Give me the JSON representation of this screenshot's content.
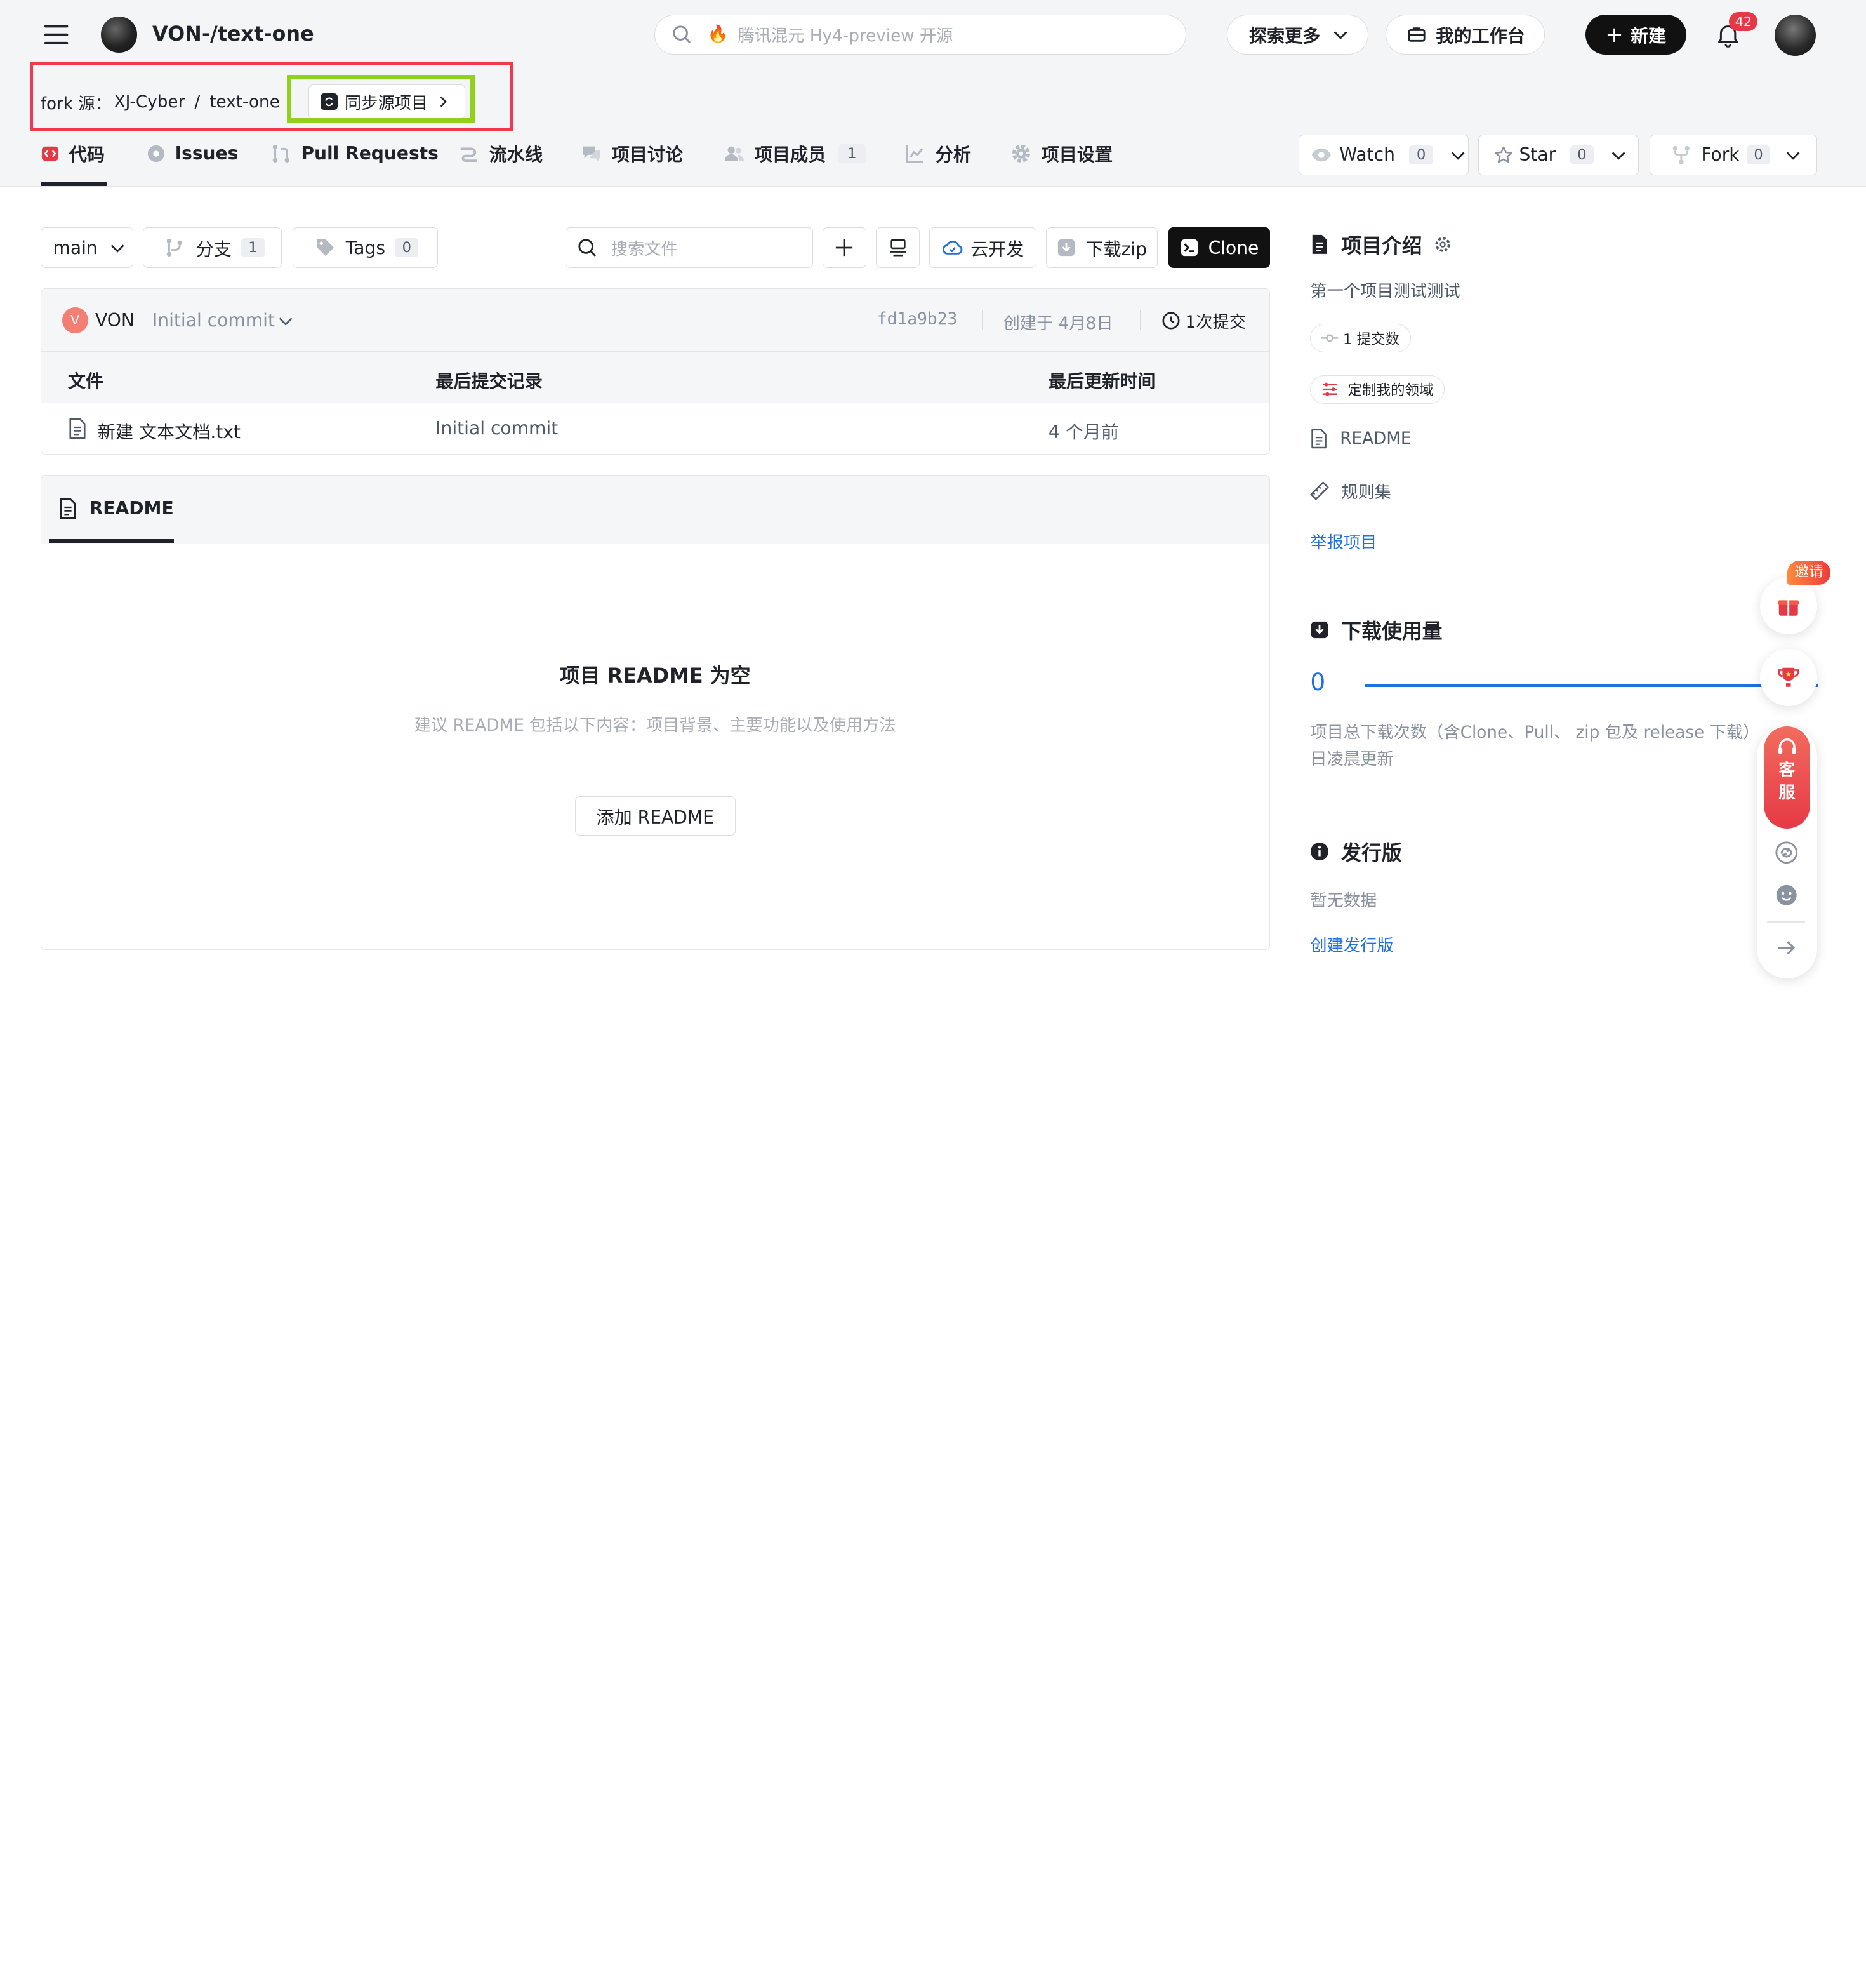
{
  "header": {
    "repo_title": "VON-/text-one",
    "search_placeholder": "腾讯混元 Hy4-preview 开源",
    "explore_label": "探索更多",
    "workbench_label": "我的工作台",
    "new_label": "新建",
    "notif_count": "42"
  },
  "fork": {
    "prefix": "fork 源：",
    "owner": "XJ-Cyber",
    "sep": "/",
    "repo": "text-one",
    "sync_label": "同步源项目"
  },
  "tabs": [
    {
      "label": "代码",
      "count": ""
    },
    {
      "label": "Issues",
      "count": ""
    },
    {
      "label": "Pull Requests",
      "count": ""
    },
    {
      "label": "流水线",
      "count": ""
    },
    {
      "label": "项目讨论",
      "count": ""
    },
    {
      "label": "项目成员",
      "count": "1"
    },
    {
      "label": "分析",
      "count": ""
    },
    {
      "label": "项目设置",
      "count": ""
    }
  ],
  "social": {
    "watch_label": "Watch",
    "watch_count": "0",
    "star_label": "Star",
    "star_count": "0",
    "fork_label": "Fork",
    "fork_count": "0"
  },
  "toolbar": {
    "branch": "main",
    "branches_label": "分支",
    "branches_count": "1",
    "tags_label": "Tags",
    "tags_count": "0",
    "search_placeholder": "搜索文件",
    "cloud_dev_label": "云开发",
    "download_zip_label": "下载zip",
    "clone_label": "Clone"
  },
  "commit": {
    "avatar_letter": "V",
    "author": "VON",
    "message": "Initial commit",
    "hash": "fd1a9b23",
    "created": "创建于 4月8日",
    "commits_label": "1次提交"
  },
  "files": {
    "col_file": "文件",
    "col_commit": "最后提交记录",
    "col_time": "最后更新时间",
    "rows": [
      {
        "name": "新建 文本文档.txt",
        "commit": "Initial commit",
        "time": "4 个月前"
      }
    ]
  },
  "readme": {
    "tab_label": "README",
    "empty_title": "项目 README 为空",
    "empty_desc": "建议 README 包括以下内容：项目背景、主要功能以及使用方法",
    "add_label": "添加 README"
  },
  "sidebar": {
    "intro_title": "项目介绍",
    "intro_desc": "第一个项目测试测试",
    "commits_tag": "1 提交数",
    "domain_tag": "定制我的领域",
    "readme_link": "README",
    "rules_link": "规则集",
    "report_link": "举报项目",
    "downloads_title": "下载使用量",
    "downloads_count": "0",
    "downloads_desc_1": "项目总下载次数（含Clone、Pull、 zip 包及 release 下载）",
    "downloads_desc_2": "日凌晨更新",
    "releases_title": "发行版",
    "releases_empty": "暂无数据",
    "releases_create": "创建发行版"
  },
  "floating": {
    "invite_label": "邀请",
    "service_label_1": "客",
    "service_label_2": "服"
  },
  "colors": {
    "accent_red": "#e63946",
    "link_blue": "#1f6fe5",
    "highlight_red_box": "#f0394a",
    "highlight_green_box": "#8fd11c"
  }
}
